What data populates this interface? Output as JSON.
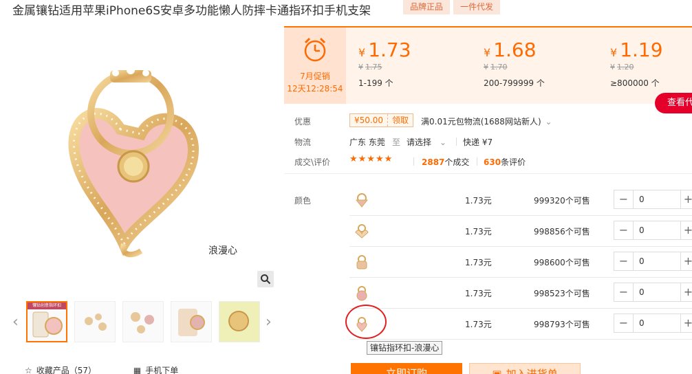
{
  "product": {
    "title": "金属镶钻适用苹果iPhone6S安卓多功能懒人防摔卡通指环扣手机支架",
    "tags": [
      "品牌正品",
      "一件代发"
    ],
    "main_caption": "浪漫心"
  },
  "gallery": {
    "prev": "‹",
    "next": "›",
    "thumbnail_caption": "镶钻创意指环扣"
  },
  "bottom_links": {
    "favorite": "收藏产品（57）",
    "mobile_order": "手机下单"
  },
  "promo": {
    "label": "7月促销",
    "timer": "12天12:28:54"
  },
  "price_tiers": [
    {
      "currency": "¥",
      "price": "1.73",
      "old_price": "1.75",
      "range": "1-199 个"
    },
    {
      "currency": "¥",
      "price": "1.68",
      "old_price": "1.70",
      "range": "200-799999 个"
    },
    {
      "currency": "¥",
      "price": "1.19",
      "old_price": "1.20",
      "range": "≥800000 个"
    }
  ],
  "more_button": "查看代",
  "info": {
    "discount_label": "优惠",
    "coupon_amount": "¥50.00",
    "coupon_action": "领取",
    "discount_text": "满0.01元包物流(1688网站新人)",
    "logistics_label": "物流",
    "origin": "广东 东莞",
    "to": "至",
    "destination": "请选择",
    "express": "快递 ¥7",
    "deal_label": "成交\\评价",
    "stars": "★★★★★",
    "deals_count": "2887",
    "deals_suffix": "个成交",
    "reviews_count": "630",
    "reviews_suffix": "条评价"
  },
  "sku": {
    "label": "颜色",
    "rows": [
      {
        "price": "1.73元",
        "stock": "999320个可售",
        "qty": "0"
      },
      {
        "price": "1.73元",
        "stock": "998856个可售",
        "qty": "0"
      },
      {
        "price": "1.73元",
        "stock": "998600个可售",
        "qty": "0"
      },
      {
        "price": "1.73元",
        "stock": "998523个可售",
        "qty": "0"
      },
      {
        "price": "1.73元",
        "stock": "998793个可售",
        "qty": "0"
      }
    ],
    "tooltip": "镶钻指环扣-浪漫心"
  },
  "actions": {
    "buy": "立即订购",
    "cart": "加入进货单"
  },
  "colors": {
    "accent": "#ff7300",
    "price": "#ff6a00",
    "red": "#e4002b"
  }
}
